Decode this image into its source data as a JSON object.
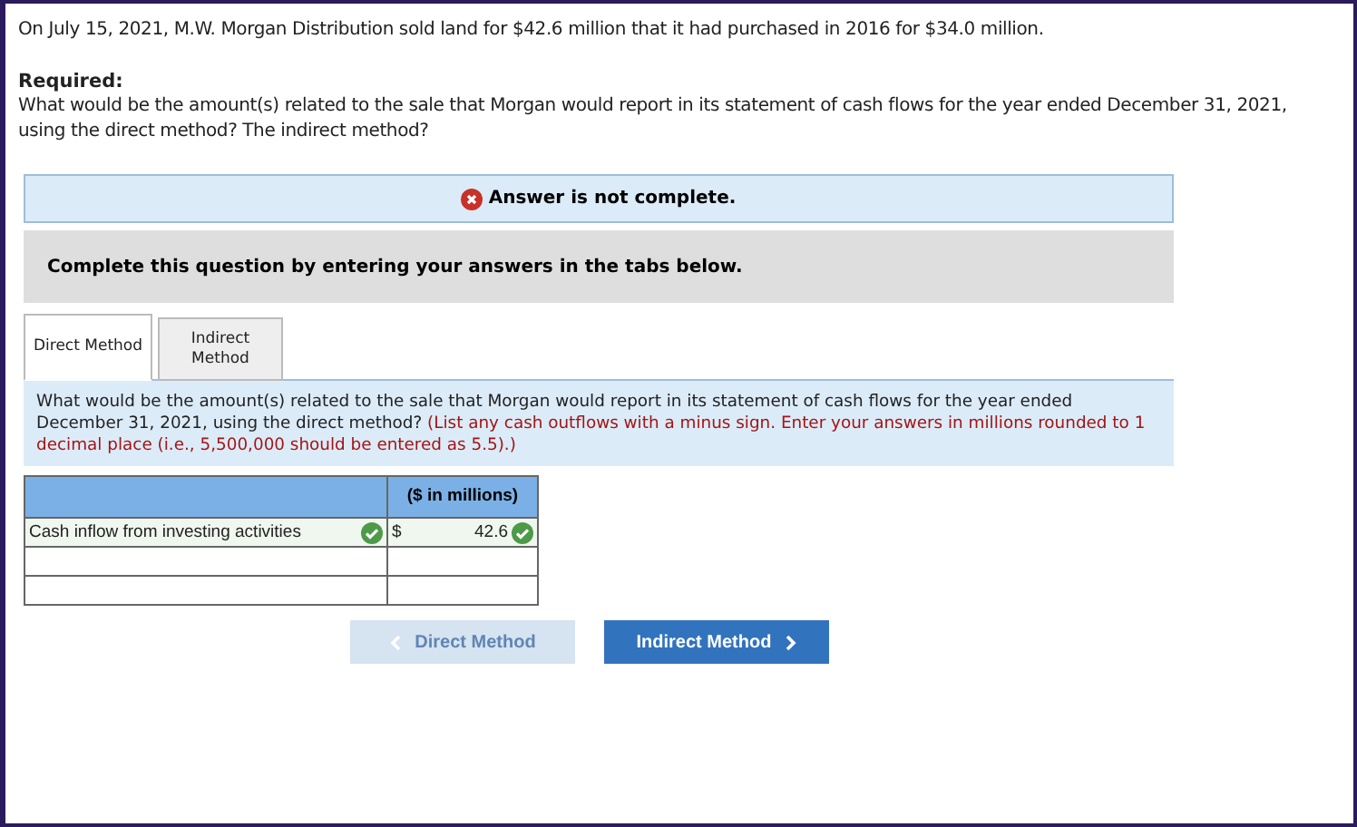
{
  "problem": {
    "text": "On July 15, 2021, M.W. Morgan Distribution sold land for $42.6 million that it had purchased in 2016 for $34.0 million.",
    "required_label": "Required:",
    "required_text": "What would be the amount(s) related to the sale that Morgan would report in its statement of cash flows for the year ended December 31, 2021, using the direct method? The indirect method?"
  },
  "status_banner": {
    "text": "Answer is not complete.",
    "complete": false
  },
  "instructions": "Complete this question by entering your answers in the tabs below.",
  "tabs": [
    {
      "label": "Direct Method",
      "selected": true
    },
    {
      "label": "Indirect Method",
      "selected": false
    }
  ],
  "question": {
    "text": "What would be the amount(s) related to the sale that Morgan would report in its statement of cash flows for the year ended December 31, 2021, using the direct method?",
    "hint": "(List any cash outflows with a minus sign. Enter your answers in millions rounded to 1 decimal place (i.e., 5,500,000 should be entered as 5.5).)"
  },
  "table": {
    "column_header": "($ in millions)",
    "rows": [
      {
        "kind": "entry",
        "label": "Cash inflow from investing activities",
        "label_correct": true,
        "currency": "$",
        "value": "42.6",
        "value_correct": true
      },
      {
        "kind": "empty"
      },
      {
        "kind": "empty"
      }
    ]
  },
  "nav_buttons": [
    {
      "label": "Direct Method",
      "kind": "prev",
      "disabled": true
    },
    {
      "label": "Indirect Method",
      "kind": "next",
      "disabled": false
    }
  ]
}
